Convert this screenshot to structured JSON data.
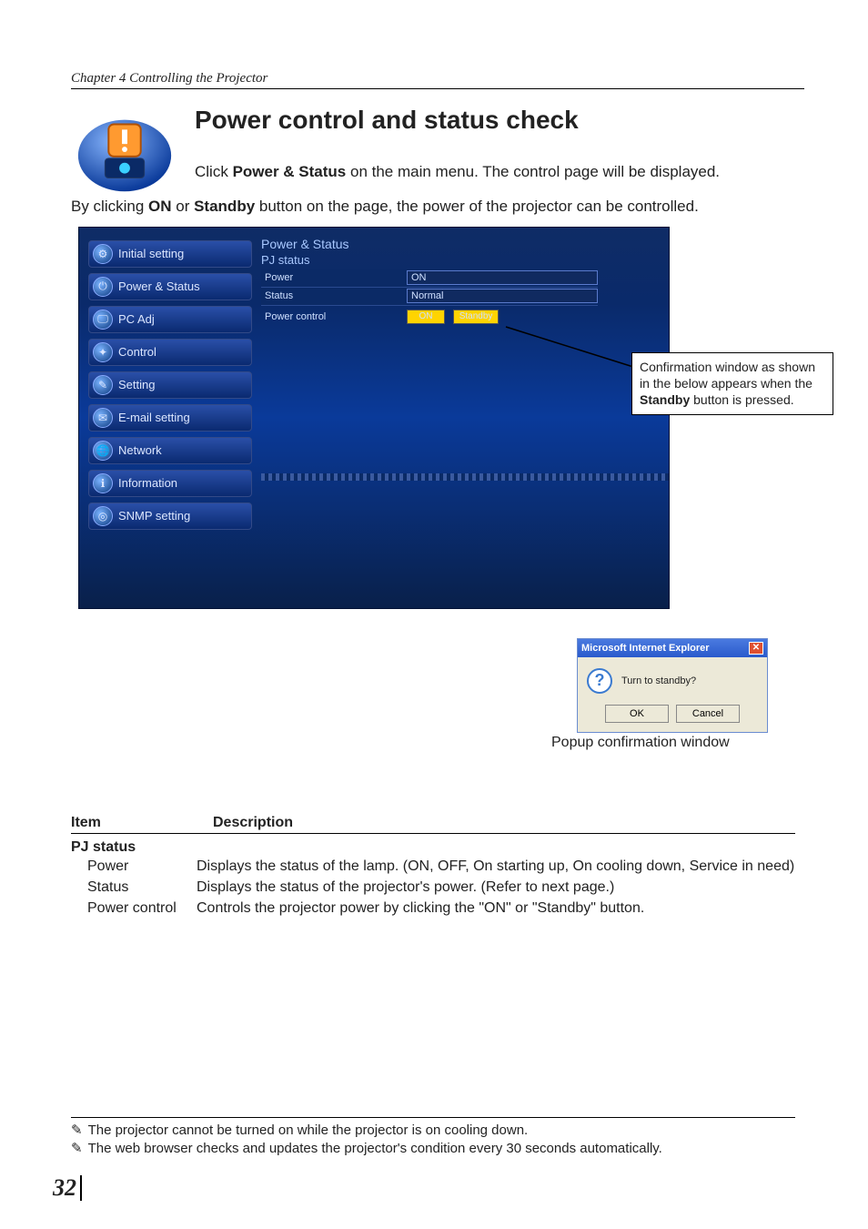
{
  "chapter": "Chapter 4 Controlling the Projector",
  "title": "Power control and status check",
  "intro1_a": "Click ",
  "intro1_b": "Power & Status",
  "intro1_c": " on the main menu. The control page will be displayed.",
  "intro2_a": "By clicking ",
  "intro2_b": "ON",
  "intro2_c": " or ",
  "intro2_d": "Standby",
  "intro2_e": " button on the page, the power of the projector can be controlled.",
  "sidebar": {
    "items": [
      "Initial setting",
      "Power & Status",
      "PC Adj",
      "Control",
      "Setting",
      "E-mail setting",
      "Network",
      "Information",
      "SNMP setting"
    ]
  },
  "panel": {
    "head": "Power & Status",
    "sub": "PJ status",
    "rows": {
      "power_label": "Power",
      "power_value": "ON",
      "status_label": "Status",
      "status_value": "Normal",
      "pc_label": "Power control",
      "btn_on": "ON",
      "btn_standby": "Standby"
    }
  },
  "callout_a": "Confirmation window  as shown in the below appears  when the ",
  "callout_b": "Standby",
  "callout_c": " button is pressed.",
  "popup": {
    "title": "Microsoft Internet Explorer",
    "msg": "Turn to standby?",
    "ok": "OK",
    "cancel": "Cancel"
  },
  "popup_caption": "Popup confirmation window",
  "table": {
    "h_item": "Item",
    "h_desc": "Description",
    "group": "PJ status",
    "rows": [
      {
        "term": "Power",
        "desc": "Displays the status of the lamp. (ON, OFF, On starting up, On cooling down, Service in need)"
      },
      {
        "term": "Status",
        "desc": "Displays the status of the projector's power. (Refer to next page.)"
      },
      {
        "term": "Power control",
        "desc": "Controls the projector power by clicking the \"ON\" or \"Standby\" button."
      }
    ]
  },
  "footnotes": [
    "The projector cannot be turned on while the projector is on cooling down.",
    "The web browser checks and updates the projector's condition every 30 seconds automatically."
  ],
  "page_number": "32"
}
